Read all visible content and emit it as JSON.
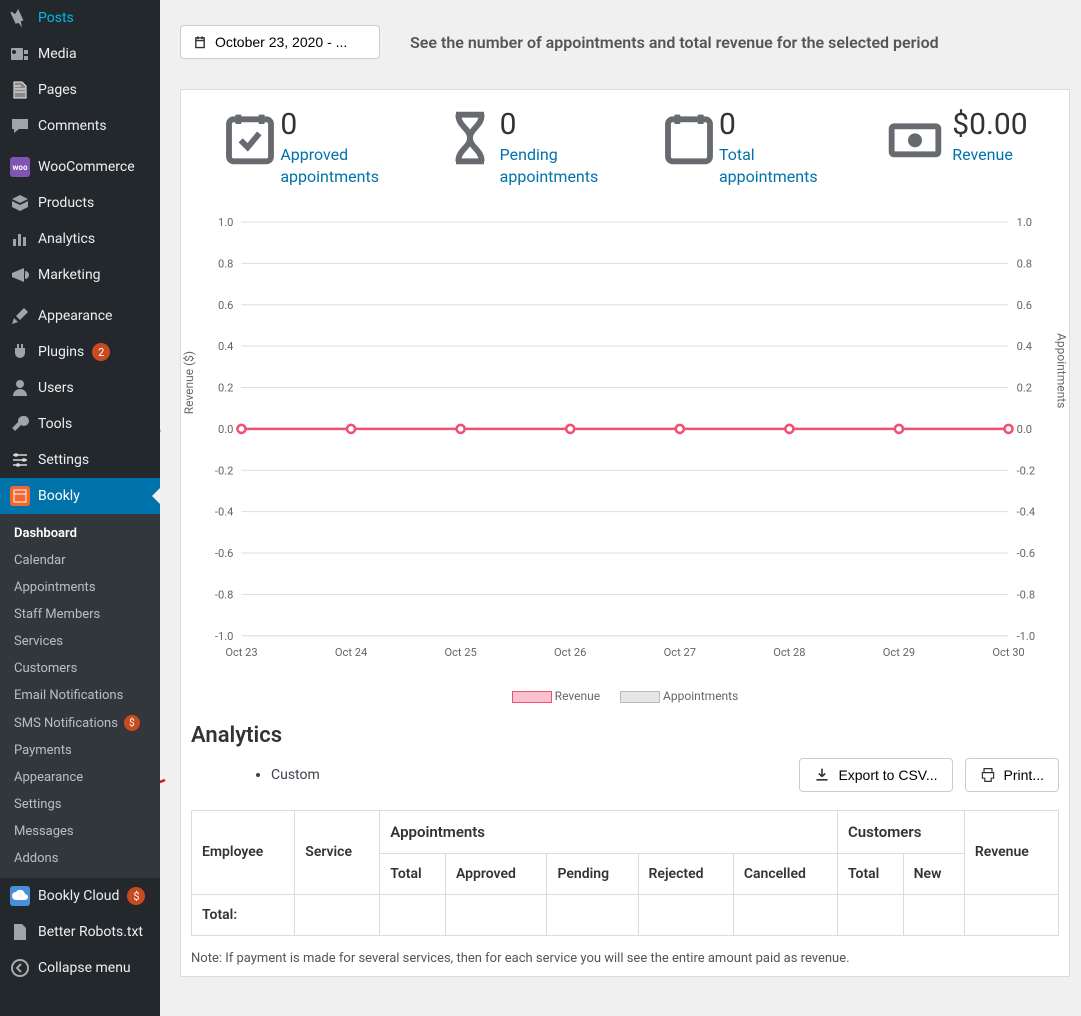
{
  "sidebar": {
    "items": [
      {
        "label": "Posts",
        "icon": "pin"
      },
      {
        "label": "Media",
        "icon": "media"
      },
      {
        "label": "Pages",
        "icon": "page"
      },
      {
        "label": "Comments",
        "icon": "comment"
      },
      {
        "label": "WooCommerce",
        "icon": "woo"
      },
      {
        "label": "Products",
        "icon": "box"
      },
      {
        "label": "Analytics",
        "icon": "bars"
      },
      {
        "label": "Marketing",
        "icon": "megaphone"
      },
      {
        "label": "Appearance",
        "icon": "brush"
      },
      {
        "label": "Plugins",
        "icon": "plug",
        "badge": "2"
      },
      {
        "label": "Users",
        "icon": "user"
      },
      {
        "label": "Tools",
        "icon": "wrench"
      },
      {
        "label": "Settings",
        "icon": "sliders"
      },
      {
        "label": "Bookly",
        "icon": "calendar",
        "active": true
      },
      {
        "label": "Bookly Cloud",
        "icon": "cloud",
        "badge": "$"
      },
      {
        "label": "Better Robots.txt",
        "icon": "doc"
      },
      {
        "label": "Collapse menu",
        "icon": "collapse"
      }
    ],
    "bookly_submenu": [
      {
        "label": "Dashboard",
        "current": true
      },
      {
        "label": "Calendar"
      },
      {
        "label": "Appointments"
      },
      {
        "label": "Staff Members"
      },
      {
        "label": "Services"
      },
      {
        "label": "Customers"
      },
      {
        "label": "Email Notifications"
      },
      {
        "label": "SMS Notifications",
        "badge": "$"
      },
      {
        "label": "Payments"
      },
      {
        "label": "Appearance"
      },
      {
        "label": "Settings"
      },
      {
        "label": "Messages"
      },
      {
        "label": "Addons"
      }
    ]
  },
  "header": {
    "date_label": "October 23, 2020 - ...",
    "subtitle": "See the number of appointments and total revenue for the selected period"
  },
  "metrics": {
    "approved": {
      "value": "0",
      "label": "Approved\nappointments"
    },
    "pending": {
      "value": "0",
      "label": "Pending\nappointments"
    },
    "total": {
      "value": "0",
      "label": "Total\nappointments"
    },
    "revenue": {
      "value": "$0.00",
      "label": "Revenue"
    }
  },
  "chart_data": {
    "type": "line",
    "categories": [
      "Oct 23",
      "Oct 24",
      "Oct 25",
      "Oct 26",
      "Oct 27",
      "Oct 28",
      "Oct 29",
      "Oct 30"
    ],
    "series": [
      {
        "name": "Revenue",
        "values": [
          0,
          0,
          0,
          0,
          0,
          0,
          0,
          0
        ],
        "color": "#f05170"
      },
      {
        "name": "Appointments",
        "values": [
          0,
          0,
          0,
          0,
          0,
          0,
          0,
          0
        ],
        "color": "#cccccc"
      }
    ],
    "y_left_label": "Revenue ($)",
    "y_right_label": "Appointments",
    "y_left_ticks": [
      "1.0",
      "0.8",
      "0.6",
      "0.4",
      "0.2",
      "0.0",
      "-0.2",
      "-0.4",
      "-0.6",
      "-0.8",
      "-1.0"
    ],
    "y_right_ticks": [
      "1.0",
      "0.8",
      "0.6",
      "0.4",
      "0.2",
      "0.0",
      "-0.2",
      "-0.4",
      "-0.6",
      "-0.8",
      "-1.0"
    ],
    "ylim": [
      -1.0,
      1.0
    ],
    "legend": [
      "Revenue",
      "Appointments"
    ]
  },
  "analytics": {
    "heading": "Analytics",
    "custom_label": "Custom",
    "export_label": "Export to CSV...",
    "print_label": "Print...",
    "group_headers": {
      "appointments": "Appointments",
      "customers": "Customers"
    },
    "columns": [
      "Employee",
      "Service",
      "Total",
      "Approved",
      "Pending",
      "Rejected",
      "Cancelled",
      "Total",
      "New",
      "Revenue"
    ],
    "total_row_label": "Total:",
    "note": "Note: If payment is made for several services, then for each service you will see the entire amount paid as revenue."
  }
}
